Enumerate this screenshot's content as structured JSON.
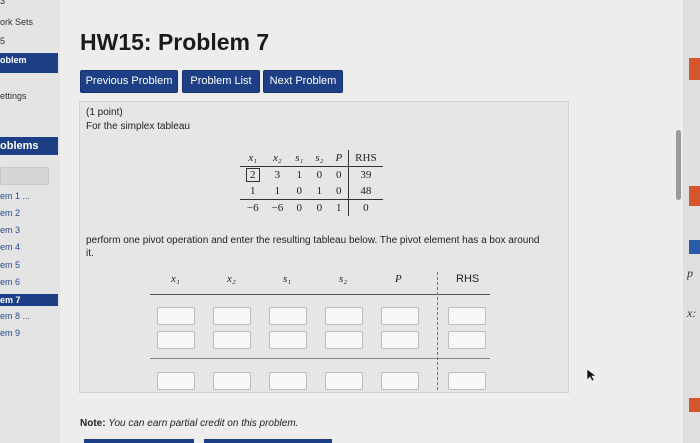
{
  "sidebar": {
    "top_fragment": "3",
    "work_sets": "ork Sets",
    "set_num": "5",
    "active_item": "oblem",
    "settings": "ettings",
    "problems_heading": "oblems",
    "problems": [
      {
        "label": "em 1 ...",
        "active": false
      },
      {
        "label": "em 2",
        "active": false
      },
      {
        "label": "em 3",
        "active": false
      },
      {
        "label": "em 4",
        "active": false
      },
      {
        "label": "em 5",
        "active": false
      },
      {
        "label": "em 6",
        "active": false
      },
      {
        "label": "em 7",
        "active": true
      },
      {
        "label": "em 8 ...",
        "active": false
      },
      {
        "label": "em 9",
        "active": false
      }
    ]
  },
  "header": {
    "title": "HW15: Problem 7"
  },
  "nav": {
    "previous": "Previous Problem",
    "list": "Problem List",
    "next": "Next Problem"
  },
  "problem": {
    "points": "(1 point)",
    "intro": "For the simplex tableau",
    "instructions_line1": "perform one pivot operation and enter the resulting tableau below. The pivot element has a box around",
    "instructions_line2": "it.",
    "tableau": {
      "headers": [
        "x1",
        "x2",
        "s1",
        "s2",
        "P",
        "RHS"
      ],
      "header_display": [
        "x₁",
        "x₂",
        "s₁",
        "s₂",
        "P",
        "RHS"
      ],
      "rows": [
        [
          "2",
          "3",
          "1",
          "0",
          "0",
          "39"
        ],
        [
          "1",
          "1",
          "0",
          "1",
          "0",
          "48"
        ],
        [
          "−6",
          "−6",
          "0",
          "0",
          "1",
          "0"
        ]
      ],
      "pivot": "row 1, column x1"
    },
    "answer_headers": [
      "x₁",
      "x₂",
      "s₁",
      "s₂",
      "P",
      "RHS"
    ]
  },
  "note": {
    "label": "Note:",
    "text": "You can earn partial credit on this problem."
  },
  "right_panel": {
    "symbols": [
      "p",
      "x:"
    ]
  },
  "colors": {
    "primary": "#1d3f86",
    "accent_red": "#d4552f"
  }
}
